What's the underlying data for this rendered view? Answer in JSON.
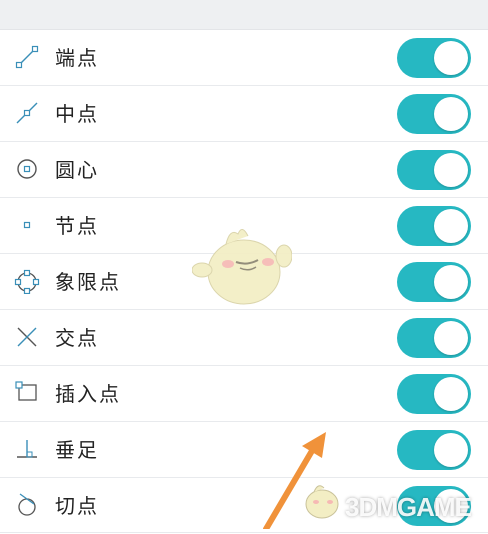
{
  "colors": {
    "toggle_on": "#26b8c2",
    "icon": "#3a8fb8"
  },
  "items": [
    {
      "label": "端点",
      "icon": "endpoint-icon",
      "enabled": true
    },
    {
      "label": "中点",
      "icon": "midpoint-icon",
      "enabled": true
    },
    {
      "label": "圆心",
      "icon": "center-icon",
      "enabled": true
    },
    {
      "label": "节点",
      "icon": "node-icon",
      "enabled": true
    },
    {
      "label": "象限点",
      "icon": "quadrant-icon",
      "enabled": true
    },
    {
      "label": "交点",
      "icon": "intersection-icon",
      "enabled": true
    },
    {
      "label": "插入点",
      "icon": "insertion-icon",
      "enabled": true
    },
    {
      "label": "垂足",
      "icon": "perpendicular-icon",
      "enabled": true
    },
    {
      "label": "切点",
      "icon": "tangent-icon",
      "enabled": true
    }
  ],
  "watermark": {
    "text": "3DMGAME"
  }
}
